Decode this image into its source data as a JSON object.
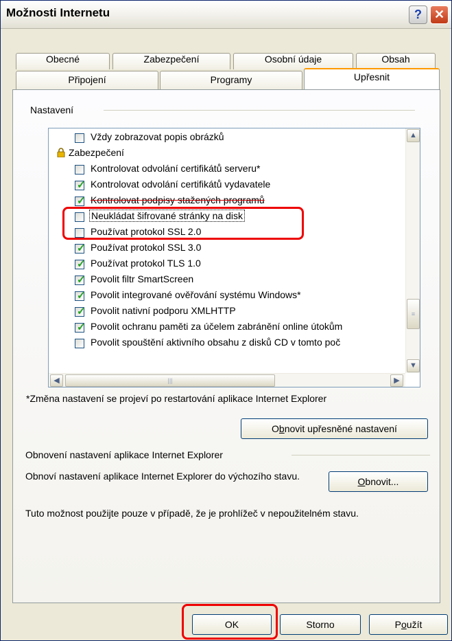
{
  "window": {
    "title": "Možnosti Internetu"
  },
  "tabs_top": [
    "Obecné",
    "Zabezpečení",
    "Osobní údaje",
    "Obsah"
  ],
  "tabs_bottom": [
    "Připojení",
    "Programy",
    "Upřesnit"
  ],
  "settings": {
    "group_label": "Nastavení",
    "items": [
      {
        "type": "checkbox",
        "checked": false,
        "label": "Vždy zobrazovat popis obrázků"
      },
      {
        "type": "category",
        "label": "Zabezpečení",
        "icon": "lock-icon"
      },
      {
        "type": "checkbox",
        "checked": false,
        "label": "Kontrolovat odvolání certifikátů serveru*"
      },
      {
        "type": "checkbox",
        "checked": true,
        "label": "Kontrolovat odvolání certifikátů vydavatele"
      },
      {
        "type": "checkbox",
        "checked": true,
        "label": "Kontrolovat podpisy stažených programů"
      },
      {
        "type": "checkbox",
        "checked": false,
        "label": "Neukládat šifrované stránky na disk",
        "selected": true
      },
      {
        "type": "checkbox",
        "checked": false,
        "label": "Používat protokol SSL 2.0"
      },
      {
        "type": "checkbox",
        "checked": true,
        "label": "Používat protokol SSL 3.0"
      },
      {
        "type": "checkbox",
        "checked": true,
        "label": "Používat protokol TLS 1.0"
      },
      {
        "type": "checkbox",
        "checked": true,
        "label": "Povolit filtr SmartScreen"
      },
      {
        "type": "checkbox",
        "checked": true,
        "label": "Povolit integrované ověřování systému Windows*"
      },
      {
        "type": "checkbox",
        "checked": true,
        "label": "Povolit nativní podporu XMLHTTP"
      },
      {
        "type": "checkbox",
        "checked": true,
        "label": "Povolit ochranu paměti za účelem zabránění online útokům"
      },
      {
        "type": "checkbox",
        "checked": false,
        "label": "Povolit spouštění aktivního obsahu z disků CD v tomto poč"
      }
    ],
    "restart_note": "*Změna nastavení se projeví po restartování aplikace Internet Explorer",
    "restore_button": {
      "pre": "O",
      "key": "b",
      "post": "novit upřesněné nastavení"
    }
  },
  "reset": {
    "group_label": "Obnovení nastavení aplikace Internet Explorer",
    "description": "Obnoví nastavení aplikace Internet Explorer do výchozího stavu.",
    "button": {
      "key": "O",
      "post": "bnovit..."
    },
    "note": "Tuto možnost použijte pouze v případě, že je prohlížeč v nepoužitelném stavu."
  },
  "footer": {
    "ok": "OK",
    "cancel": "Storno",
    "apply": {
      "pre": "P",
      "key": "o",
      "post": "užít"
    }
  },
  "colors": {
    "check_green": "#21a121",
    "highlight_red": "#e00000",
    "title_text": "#000000"
  }
}
